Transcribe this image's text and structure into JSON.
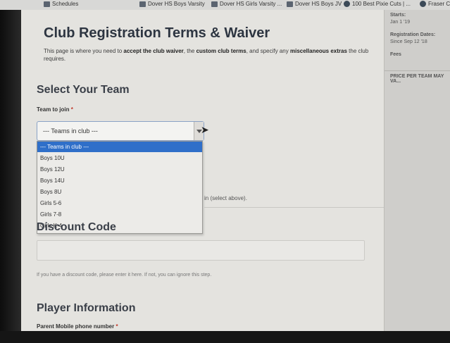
{
  "bookmarks": [
    {
      "label": "Schedules",
      "icon": "folder-icon"
    },
    {
      "label": "Dover HS Boys Varsity",
      "icon": "folder-icon"
    },
    {
      "label": "Dover HS Girls Varsity ...",
      "icon": "folder-icon"
    },
    {
      "label": "Dover HS Boys JV",
      "icon": "folder-icon"
    },
    {
      "label": "100 Best Pixie Cuts | ...",
      "icon": "globe-icon"
    },
    {
      "label": "Fraser C...",
      "icon": "globe-icon"
    }
  ],
  "page": {
    "title": "Club Registration Terms & Waiver",
    "intro_1": "This page is where you need to ",
    "intro_b1": "accept the club waiver",
    "intro_2": ", the ",
    "intro_b2": "custom club terms",
    "intro_3": ", and specify any ",
    "intro_b3": "miscellaneous extras",
    "intro_4": " the club requires."
  },
  "team": {
    "heading": "Select Your Team",
    "label": "Team to join",
    "required_mark": "*",
    "selected": "--- Teams in club ---",
    "options": [
      "--- Teams in club ---",
      "Boys 10U",
      "Boys 12U",
      "Boys 14U",
      "Boys 8U",
      "Girls 5-6",
      "Girls 7-8",
      "Girls K-4"
    ],
    "hint_partial": "in (select above)."
  },
  "discount": {
    "heading": "Discount Code",
    "hint": "If you have a discount code, please enter it here. If not, you can ignore this step."
  },
  "player": {
    "heading": "Player Information",
    "phone_label": "Parent Mobile phone number",
    "required_mark": "*"
  },
  "sidebar": {
    "starts_label": "Starts:",
    "starts_value": "Jan 1 '19",
    "reg_label": "Registration Dates:",
    "reg_value": "Since Sep 12 '18",
    "fees_label": "Fees",
    "price_label": "PRICE PER TEAM MAY VA..."
  }
}
